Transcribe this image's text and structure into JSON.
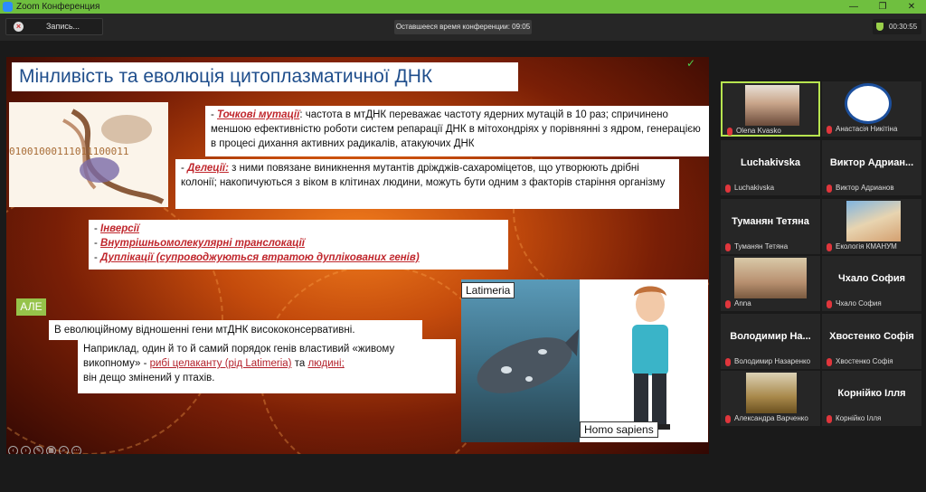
{
  "window": {
    "title": "Zoom Конференция",
    "controls": [
      "—",
      "❐",
      "✕"
    ]
  },
  "toolbar": {
    "record_label": "Запись...",
    "remaining_time": "Оставшееся время конференции: 09:05",
    "clock": "00:30:55"
  },
  "slide": {
    "title": "Мінливість та еволюція цитоплазматичної ДНК",
    "binary_text": "01001000111011100011",
    "point": {
      "dash": "- ",
      "term": "Точкові мутації",
      "text": ": частота в мтДНК переважає частоту ядерних мутацій в 10 раз; спричинено меншою ефективністю роботи систем репарації ДНК в мітохондріях у порівнянні з ядром, генерацією в процесі дихання активних радикалів, атакуючих ДНК"
    },
    "deletions": {
      "dash": "- ",
      "term": "Делеції:",
      "text": " з ними повязане виникнення мутантів дріжджів-сахароміцетов, що утворюють дрібні колонії; накопичуються з віком в клітинах людини, можуть бути одним з факторів старіння організму"
    },
    "list": [
      {
        "dash": "- ",
        "term": "Інверсії"
      },
      {
        "dash": "- ",
        "term": "Внутрішньомолекулярні транслокації"
      },
      {
        "dash": "- ",
        "term": "Дуплікації (супроводжуються втратою дуплікованих генів)"
      }
    ],
    "ale": "АЛЕ",
    "conservative": "В еволюційному відношенні гени мтДНК висококонсервативні.",
    "example": {
      "part1": "Наприклад, один й то й самий порядок генів властивий «живому викопному» - ",
      "link1": "рибі целаканту (рід Latimeria)",
      "part2": " та ",
      "link2": "людині;",
      "part3": "він дещо змінений у птахів."
    },
    "fish_label": "Latimeria",
    "human_label": "Homo sapiens"
  },
  "participants": [
    {
      "name": "",
      "label": "Olena Kvasko",
      "photo": true,
      "active": true
    },
    {
      "name": "",
      "label": "Анастасія Никітіна",
      "photo": true,
      "logo": true
    },
    {
      "name": "Luchakivska",
      "label": "Luchakivska"
    },
    {
      "name": "Виктор  Адриан...",
      "label": "Виктор Адрианов"
    },
    {
      "name": "Туманян Тетяна",
      "label": "Туманян Тетяна"
    },
    {
      "name": "",
      "label": "Екологія КМАНУМ",
      "photo": true
    },
    {
      "name": "",
      "label": "Anna",
      "photo": true
    },
    {
      "name": "Чхало София",
      "label": "Чхало София"
    },
    {
      "name": "Володимир  На...",
      "label": "Володимир Назаренко"
    },
    {
      "name": "Хвостенко Софія",
      "label": "Хвостенко Софія"
    },
    {
      "name": "",
      "label": "Александра Варченко",
      "photo": true
    },
    {
      "name": "Корнійко Ілля",
      "label": "Корнійко Ілля"
    }
  ],
  "colors": {
    "titlebar": "#6fbf3f",
    "accent_red": "#c0272d",
    "slide_title": "#1f4e8c",
    "ale": "#96c34a",
    "active_speaker": "#b7e44f"
  }
}
